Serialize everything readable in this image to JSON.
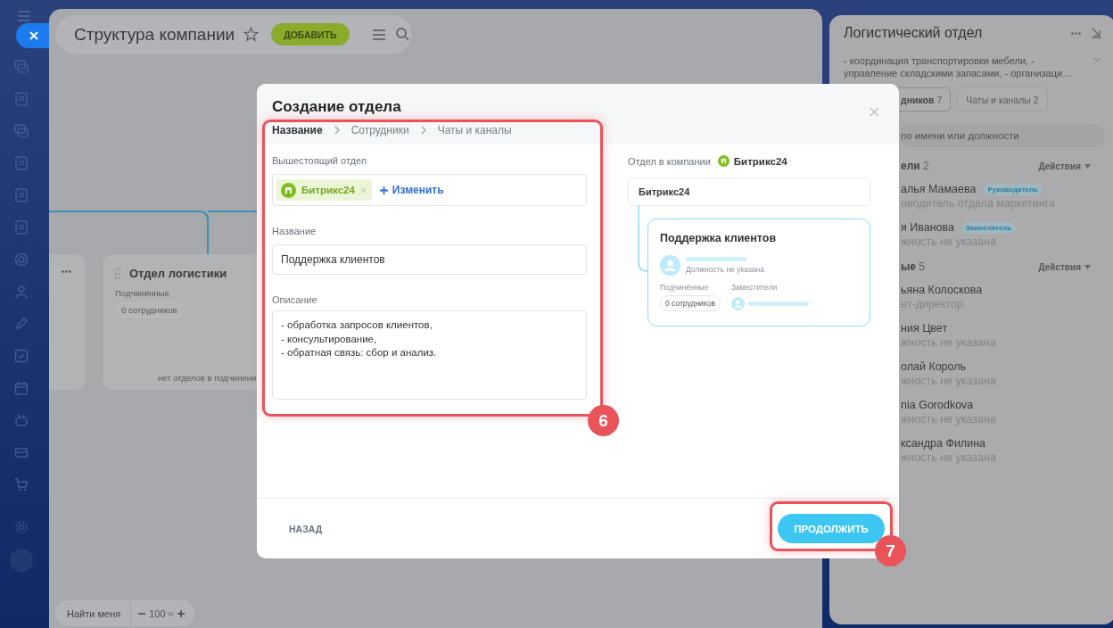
{
  "header": {
    "title": "Структура компании",
    "add_button": "ДОБАВИТЬ"
  },
  "canvas": {
    "cards": [
      {
        "kind": "stub"
      },
      {
        "kind": "department",
        "title": "Отдел логистики",
        "subordinates_label": "Подчинённые",
        "count": "0 сотрудников",
        "footer": "нет отделов в подчинени"
      }
    ]
  },
  "zoom_bar": {
    "find_me": "Найти меня",
    "zoom": "100",
    "unit": "%"
  },
  "side_panel": {
    "title": "Логистический отдел",
    "description": "- координация транспортировки мебели, - управление складскими запасами, - организаци…",
    "tabs": [
      {
        "label": "дников",
        "count": "7",
        "selected": true
      },
      {
        "label": "Чаты и каналы",
        "count": "2",
        "selected": false
      }
    ],
    "search_placeholder": "по имени или должности",
    "sections": [
      {
        "title": "ели",
        "count": "2",
        "action": "Действия",
        "people": [
          {
            "name": "алья Мамаева",
            "badge": "Руководитель",
            "position": "оводитель отдела маркетинга"
          },
          {
            "name": "я Иванова",
            "badge": "Заместитель",
            "position": "жность не указана"
          }
        ]
      },
      {
        "title": "ые",
        "count": "5",
        "action": "Действия",
        "people": [
          {
            "name": "ьяна Колоскова",
            "position": "нт-директор"
          },
          {
            "name": "ния Цвет",
            "position": "жность не указана"
          },
          {
            "name": "олай Король",
            "position": "жность не указана"
          },
          {
            "name": "nia Gorodkova",
            "position": "жность не указана"
          },
          {
            "name": "ксандра Филина",
            "position": "жность не указана"
          }
        ]
      }
    ]
  },
  "modal": {
    "title": "Создание отдела",
    "steps": [
      {
        "label": "Название",
        "selected": true
      },
      {
        "label": "Сотрудники",
        "selected": false
      },
      {
        "label": "Чаты и каналы",
        "selected": false
      }
    ],
    "parent_label": "Вышестоящий отдел",
    "parent_tag": "Битрикс24",
    "change_link": "Изменить",
    "name_label": "Название",
    "name_value": "Поддержка клиентов",
    "description_label": "Описание",
    "description_value": "- обработка запросов клиентов,\n- консультирование,\n- обратная связь: сбор и анализ.",
    "preview": {
      "label": "Отдел в компании",
      "company": "Битрикс24",
      "root": "Битрикс24",
      "card_title": "Поддержка клиентов",
      "position": "Должность не указана",
      "subordinates_label": "Подчинённые",
      "subordinates_count": "0 сотрудников",
      "deputies_label": "Заместители"
    },
    "back_button": "НАЗАД",
    "continue_button": "ПРОДОЛЖИТЬ"
  },
  "callouts": [
    {
      "number": "6"
    },
    {
      "number": "7"
    }
  ]
}
